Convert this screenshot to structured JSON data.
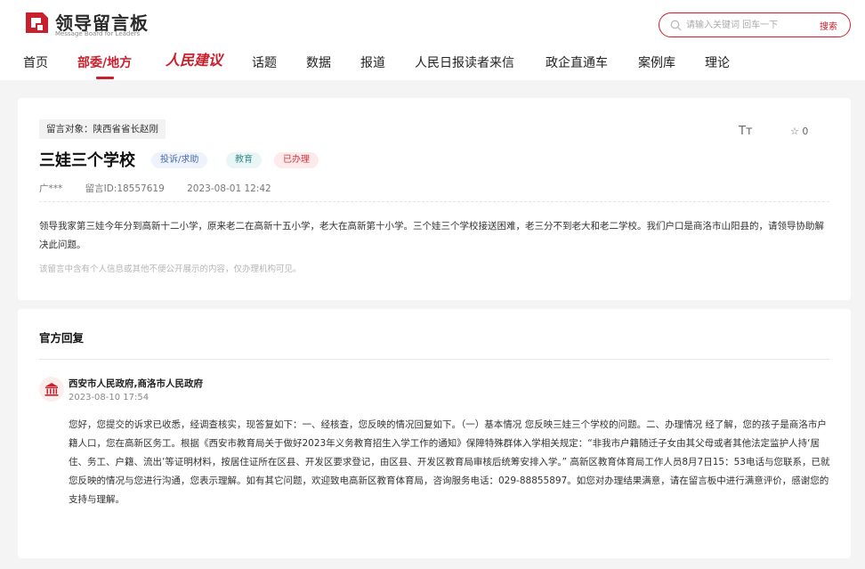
{
  "header": {
    "logo_cn": "领导留言板",
    "logo_en": "Message Board for Leaders",
    "search_placeholder": "请输入关键词 回车一下",
    "search_button": "搜索"
  },
  "nav": {
    "items": [
      "首页",
      "部委/地方",
      "人民建议",
      "话题",
      "数据",
      "报道",
      "人民日报读者来信",
      "政企直通车",
      "案例库",
      "理论"
    ],
    "active_index": 1
  },
  "message": {
    "target": "留言对象：陕西省省长赵刚",
    "title": "三娃三个学校",
    "tags": [
      "投诉/求助",
      "教育",
      "已办理"
    ],
    "font_tool": "Tт",
    "star_count": "0",
    "author": "广***",
    "message_id": "留言ID:18557619",
    "datetime": "2023-08-01 12:42",
    "body": "领导我家第三娃今年分到高新十二小学，原来老二在高新十五小学，老大在高新第十小学。三个娃三个学校接送困难，老三分不到老大和老二学校。我们户口是商洛市山阳县的，请领导协助解决此问题。",
    "notice": "该留言中含有个人信息或其他不便公开展示的内容，仅办理机构可见。"
  },
  "reply": {
    "heading": "官方回复",
    "org": "西安市人民政府,商洛市人民政府",
    "date": "2023-08-10 17:54",
    "text": "您好，您提交的诉求已收悉，经调查核实，现答复如下：一、经核查，您反映的情况回复如下。（一）基本情况 您反映三娃三个学校的问题。二、办理情况 经了解，您的孩子是商洛市户籍人口，您在高新区务工。根据《西安市教育局关于做好2023年义务教育招生入学工作的通知》保障特殊群体入学相关规定：“非我市户籍随迁子女由其父母或者其他法定监护人持‘居住、务工、户籍、流出’等证明材料，按居住证所在区县、开发区要求登记，由区县、开发区教育局审核后统筹安排入学。” 高新区教育体育局工作人员8月7日15：53电话与您联系，已就您反映的情况与您进行沟通，您表示理解。如有其它问题，欢迎致电高新区教育体育局，咨询服务电话：029-88855897。如您对办理结果满意，请在留言板中进行满意评价，感谢您的支持与理解。"
  },
  "colors": {
    "accent": "#c9202d",
    "background": "#f4f4f4"
  },
  "icons": [
    "logo-mark-icon",
    "search-icon",
    "star-icon",
    "government-building-icon"
  ]
}
